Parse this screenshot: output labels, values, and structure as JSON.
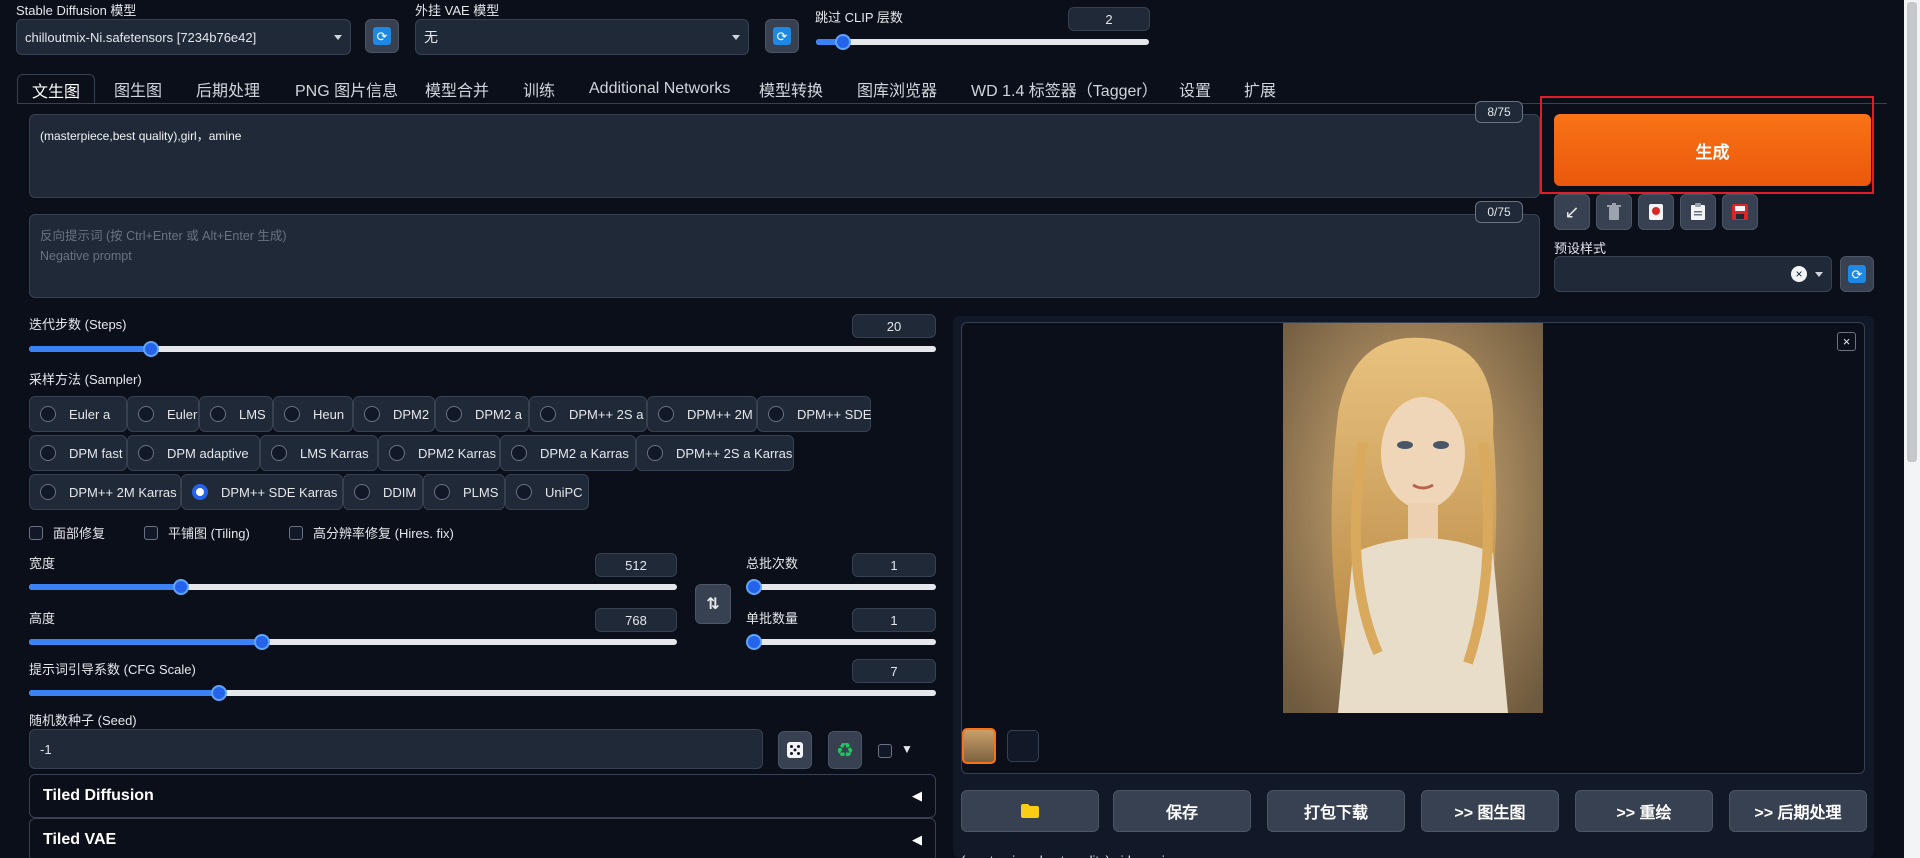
{
  "model": {
    "label": "Stable Diffusion 模型",
    "value": "chilloutmix-Ni.safetensors [7234b76e42]"
  },
  "vae": {
    "label": "外挂 VAE 模型",
    "value": "无"
  },
  "clip": {
    "label": "跳过 CLIP 层数",
    "value": "2",
    "fraction": 0.08
  },
  "tabs": [
    "文生图",
    "图生图",
    "后期处理",
    "PNG 图片信息",
    "模型合并",
    "训练",
    "Additional Networks",
    "模型转换",
    "图库浏览器",
    "WD 1.4 标签器（Tagger）",
    "设置",
    "扩展"
  ],
  "prompt": {
    "value": "(masterpiece,best quality),girl，amine",
    "token_count": "8/75"
  },
  "negative": {
    "placeholder": "反向提示词 (按 Ctrl+Enter 或 Alt+Enter 生成)\nNegative prompt",
    "token_count": "0/75"
  },
  "generate": {
    "label": "生成"
  },
  "styles": {
    "label": "预设样式",
    "clear": "×"
  },
  "steps": {
    "label": "迭代步数 (Steps)",
    "value": "20",
    "fraction": 0.134
  },
  "sampler": {
    "label": "采样方法 (Sampler)",
    "selected": "DPM++ SDE Karras",
    "rows": [
      [
        "Euler a",
        "Euler",
        "LMS",
        "Heun",
        "DPM2",
        "DPM2 a",
        "DPM++ 2S a",
        "DPM++ 2M",
        "DPM++ SDE"
      ],
      [
        "DPM fast",
        "DPM adaptive",
        "LMS Karras",
        "DPM2 Karras",
        "DPM2 a Karras",
        "DPM++ 2S a Karras"
      ],
      [
        "DPM++ 2M Karras",
        "DPM++ SDE Karras",
        "DDIM",
        "PLMS",
        "UniPC"
      ]
    ]
  },
  "checkboxes": [
    "面部修复",
    "平铺图 (Tiling)",
    "高分辨率修复 (Hires. fix)"
  ],
  "width": {
    "label": "宽度",
    "value": "512",
    "fraction": 0.235
  },
  "height": {
    "label": "高度",
    "value": "768",
    "fraction": 0.36
  },
  "batch_count": {
    "label": "总批次数",
    "value": "1",
    "fraction": 0.0
  },
  "batch_size": {
    "label": "单批数量",
    "value": "1",
    "fraction": 0.0
  },
  "cfg": {
    "label": "提示词引导系数 (CFG Scale)",
    "value": "7",
    "fraction": 0.21
  },
  "seed": {
    "label": "随机数种子 (Seed)",
    "value": "-1"
  },
  "accordions": [
    "Tiled Diffusion",
    "Tiled VAE"
  ],
  "gallery_buttons": [
    "保存",
    "打包下载",
    ">> 图生图",
    ">> 重绘",
    ">> 后期处理"
  ],
  "output_caption": "(masterpiece,best quality),girl，amine",
  "colors": {
    "accent": "#f97316",
    "primary": "#2563eb",
    "bg": "#0b0f19",
    "panel": "#1f2937",
    "highlight_border": "#e11d2a"
  },
  "icons": [
    "refresh-icon",
    "arrow-icon",
    "trash-icon",
    "card-icon",
    "paste-icon",
    "save-icon",
    "swap-icon",
    "dice-icon",
    "recycle-icon",
    "folder-icon",
    "close-icon"
  ]
}
